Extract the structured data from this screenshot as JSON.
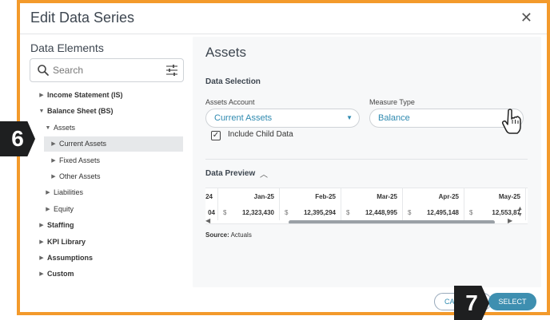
{
  "dialog": {
    "title": "Edit Data Series",
    "close_glyph": "✕"
  },
  "left": {
    "title": "Data Elements",
    "search_placeholder": "Search",
    "tree": [
      {
        "label": "Income Statement (IS)",
        "bold": true,
        "level": 0,
        "expanded": false
      },
      {
        "label": "Balance Sheet (BS)",
        "bold": true,
        "level": 0,
        "expanded": true
      },
      {
        "label": "Assets",
        "bold": false,
        "level": 1,
        "expanded": true
      },
      {
        "label": "Current Assets",
        "bold": false,
        "level": 2,
        "expanded": false,
        "selected": true
      },
      {
        "label": "Fixed Assets",
        "bold": false,
        "level": 2,
        "expanded": false
      },
      {
        "label": "Other Assets",
        "bold": false,
        "level": 2,
        "expanded": false
      },
      {
        "label": "Liabilities",
        "bold": false,
        "level": 1,
        "expanded": false
      },
      {
        "label": "Equity",
        "bold": false,
        "level": 1,
        "expanded": false
      },
      {
        "label": "Staffing",
        "bold": true,
        "level": 0,
        "expanded": false
      },
      {
        "label": "KPI Library",
        "bold": true,
        "level": 0,
        "expanded": false
      },
      {
        "label": "Assumptions",
        "bold": true,
        "level": 0,
        "expanded": false
      },
      {
        "label": "Custom",
        "bold": true,
        "level": 0,
        "expanded": false
      }
    ]
  },
  "panel": {
    "title": "Assets",
    "section": "Data Selection",
    "assets_account_label": "Assets Account",
    "assets_account_value": "Current Assets",
    "measure_type_label": "Measure Type",
    "measure_type_value": "Balance",
    "include_child_label": "Include Child Data",
    "include_child_checked": true,
    "preview_title": "Data Preview",
    "preview": {
      "partial_first_header": "24",
      "partial_first_value": "04",
      "currency": "$",
      "columns": [
        {
          "header": "Jan-25",
          "value": "12,323,430"
        },
        {
          "header": "Feb-25",
          "value": "12,395,294"
        },
        {
          "header": "Mar-25",
          "value": "12,448,995"
        },
        {
          "header": "Apr-25",
          "value": "12,495,148"
        },
        {
          "header": "May-25",
          "value": "12,553,87"
        }
      ]
    },
    "source_label": "Source:",
    "source_value": "Actuals"
  },
  "footer": {
    "cancel_label": "CA",
    "select_label": "SELECT"
  },
  "callouts": {
    "step_a": "6",
    "step_b": "7"
  },
  "colors": {
    "accent_border": "#f39a2b",
    "primary": "#3e8fb0",
    "link": "#2f8ab0"
  }
}
